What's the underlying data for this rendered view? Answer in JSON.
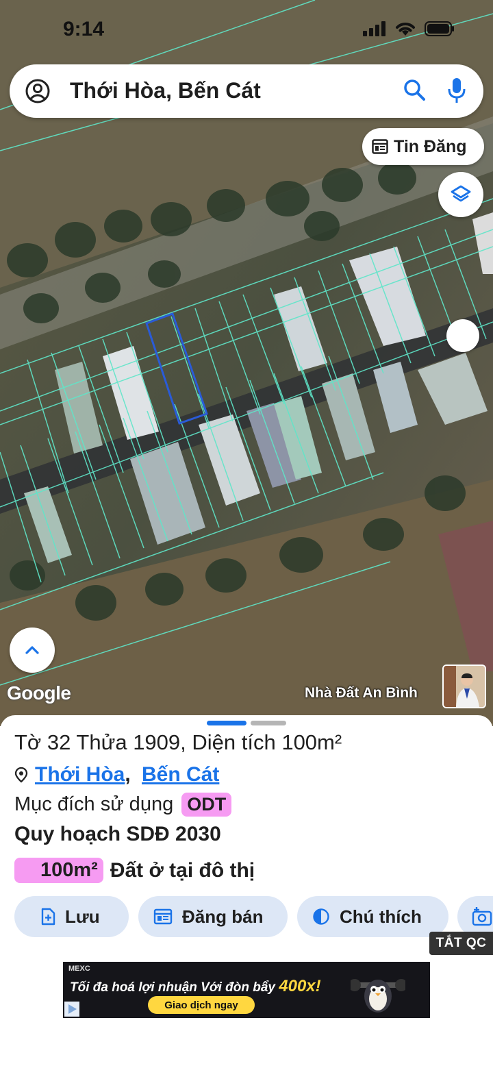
{
  "status_bar": {
    "time": "9:14"
  },
  "search": {
    "query": "Thới Hòa, Bến Cát"
  },
  "map": {
    "tin_dang_label": "Tin Đăng",
    "google_label": "Google",
    "owner_label": "Nhà Đất An Bình"
  },
  "parcel": {
    "title": "Tờ 32 Thửa 1909, Diện tích 100m²",
    "ward": "Thới Hòa",
    "separator": ",",
    "district": "Bến Cát",
    "purpose_label": "Mục đích sử dụng",
    "purpose_code": "ODT",
    "plan_title": "Quy hoạch SDĐ 2030",
    "plan_area": "100m²",
    "plan_desc": "Đất ở tại đô thị"
  },
  "actions": {
    "save": "Lưu",
    "post_sale": "Đăng bán",
    "legend": "Chú thích"
  },
  "ad": {
    "close_label": "TẮT QC",
    "brand": "MEXC",
    "headline": "Tối đa hoá lợi nhuận Với đòn bẩy",
    "highlight": "400x!",
    "cta": "Giao dịch ngay"
  },
  "colors": {
    "accent": "#1a73e8",
    "badge_pink": "#f69bf2",
    "parcel_lines": "#5fe6c9",
    "selected_parcel": "#2a5bd7"
  }
}
